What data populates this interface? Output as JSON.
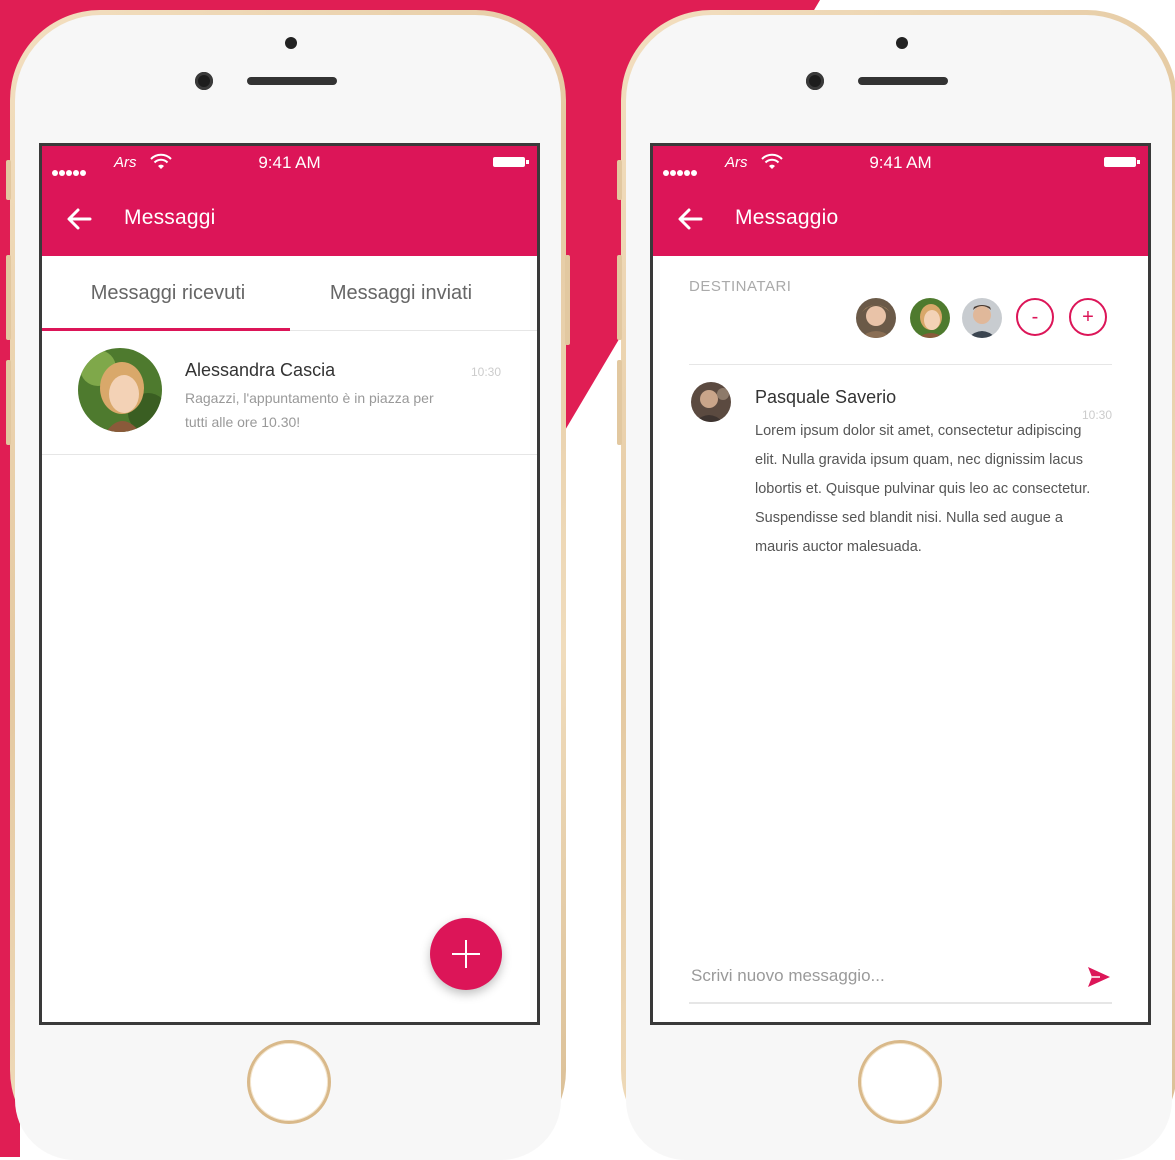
{
  "colors": {
    "accent": "#dc1558",
    "gold_frame": "#e4c9a1"
  },
  "left_phone": {
    "status": {
      "carrier": "Ars",
      "time": "9:41 AM"
    },
    "appbar": {
      "title": "Messaggi"
    },
    "tabs": [
      {
        "label": "Messaggi ricevuti",
        "active": true
      },
      {
        "label": "Messaggi inviati",
        "active": false
      }
    ],
    "messages": [
      {
        "sender": "Alessandra Cascia",
        "time": "10:30",
        "preview": "Ragazzi, l'appuntamento è in piazza per tutti alle ore 10.30!"
      }
    ],
    "fab_icon": "plus-icon"
  },
  "right_phone": {
    "status": {
      "carrier": "Ars",
      "time": "9:41 AM"
    },
    "appbar": {
      "title": "Messaggio"
    },
    "recipients_label": "DESTINATARI",
    "recipient_actions": {
      "remove": "-",
      "add": "+"
    },
    "message": {
      "sender": "Pasquale Saverio",
      "time": "10:30",
      "body": "Lorem ipsum dolor sit amet, consectetur adipiscing elit. Nulla gravida ipsum quam, nec dignissim lacus lobortis et. Quisque pulvinar quis leo ac consectetur. Suspendisse sed blandit nisi. Nulla sed augue a mauris auctor malesuada."
    },
    "compose": {
      "placeholder": "Scrivi nuovo messaggio..."
    }
  }
}
